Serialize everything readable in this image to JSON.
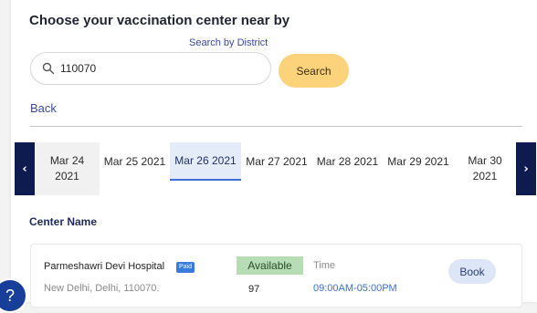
{
  "header": {
    "title": "Choose your vaccination center near by",
    "search_by_district": "Search by District"
  },
  "search": {
    "icon": "search-icon",
    "value": "110070",
    "button_label": "Search"
  },
  "nav": {
    "back_label": "Back"
  },
  "dates": {
    "prev_icon": "chevron-left-icon",
    "next_icon": "chevron-right-icon",
    "prev_glyph": "‹",
    "next_glyph": "›",
    "items": [
      {
        "line1": "Mar 24",
        "line2": "2021"
      },
      {
        "line1": "Mar 25 2021",
        "line2": ""
      },
      {
        "line1": "Mar 26 2021",
        "line2": "",
        "selected": true
      },
      {
        "line1": "Mar 27 2021",
        "line2": ""
      },
      {
        "line1": "Mar 28 2021",
        "line2": ""
      },
      {
        "line1": "Mar 29 2021",
        "line2": ""
      },
      {
        "line1": "Mar 30",
        "line2": "2021"
      }
    ]
  },
  "results": {
    "column_label": "Center Name",
    "centers": [
      {
        "name": "Parmeshawri Devi Hospital",
        "badge": "Paid",
        "address": "New Delhi, Delhi, 110070.",
        "availability_label": "Available",
        "availability_count": "97",
        "time_label": "Time",
        "time_value": "09:00AM-05:00PM",
        "book_label": "Book"
      }
    ]
  },
  "help": {
    "icon": "help-icon",
    "glyph": "?"
  },
  "colors": {
    "accent": "#fcd27b",
    "nav_dark": "#0d1b4f",
    "link": "#3a4a9f",
    "available": "#b7ddb4",
    "paid": "#3d7ae0"
  }
}
